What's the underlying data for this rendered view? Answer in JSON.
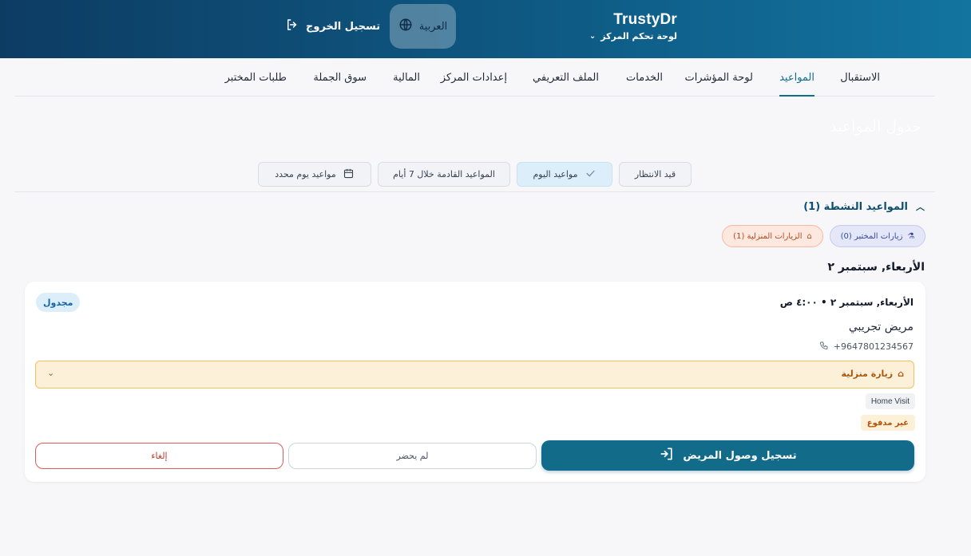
{
  "header": {
    "brand_name": "TrustyDr",
    "brand_subtitle": "لوحة تحكم المركز",
    "language_label": "العربية",
    "logout_label": "تسجيل الخروج"
  },
  "nav": {
    "tabs": [
      {
        "label": "الاستقبال",
        "active": false
      },
      {
        "label": "المواعيد",
        "active": true
      },
      {
        "label": "لوحة المؤشرات",
        "active": false
      },
      {
        "label": "الخدمات",
        "active": false
      },
      {
        "label": "الملف التعريفي",
        "active": false
      },
      {
        "label": "إعدادات المركز",
        "active": false
      },
      {
        "label": "المالية",
        "active": false
      },
      {
        "label": "سوق الجملة",
        "active": false
      },
      {
        "label": "طلبات المختبر",
        "active": false
      }
    ]
  },
  "page_title": "جدول المواعيد",
  "filters": {
    "pending": "قيد الانتظار",
    "today": "مواعيد اليوم",
    "upcoming": "المواعيد القادمة خلال 7 أيام",
    "specific_day": "مواعيد يوم محدد"
  },
  "section": {
    "title": "المواعيد النشطة (1)",
    "lab_visits": "زيارات المختبر (0)",
    "home_visits": "الزيارات المنزلية (1)"
  },
  "date_heading": "الأربعاء, سبتمبر ٢",
  "appointment": {
    "datetime": "الأربعاء, سبتمبر ٢ • ٤:٠٠ ص",
    "status": "مجدول",
    "patient_name": "مريض تجريبي",
    "phone": "+9647801234567",
    "visit_type": "زيارة منزلية",
    "service": "Home Visit",
    "payment_status": "غير مدفوع",
    "checkin_label": "تسجيل وصول المريض",
    "noshow_label": "لم يحضر",
    "cancel_label": "إلغاء"
  },
  "colors": {
    "header_start": "#0d3c63",
    "header_end": "#1374a0",
    "accent": "#136b8a",
    "home_visit_bg": "#fdf0d9",
    "cancel": "#e05a5a"
  }
}
